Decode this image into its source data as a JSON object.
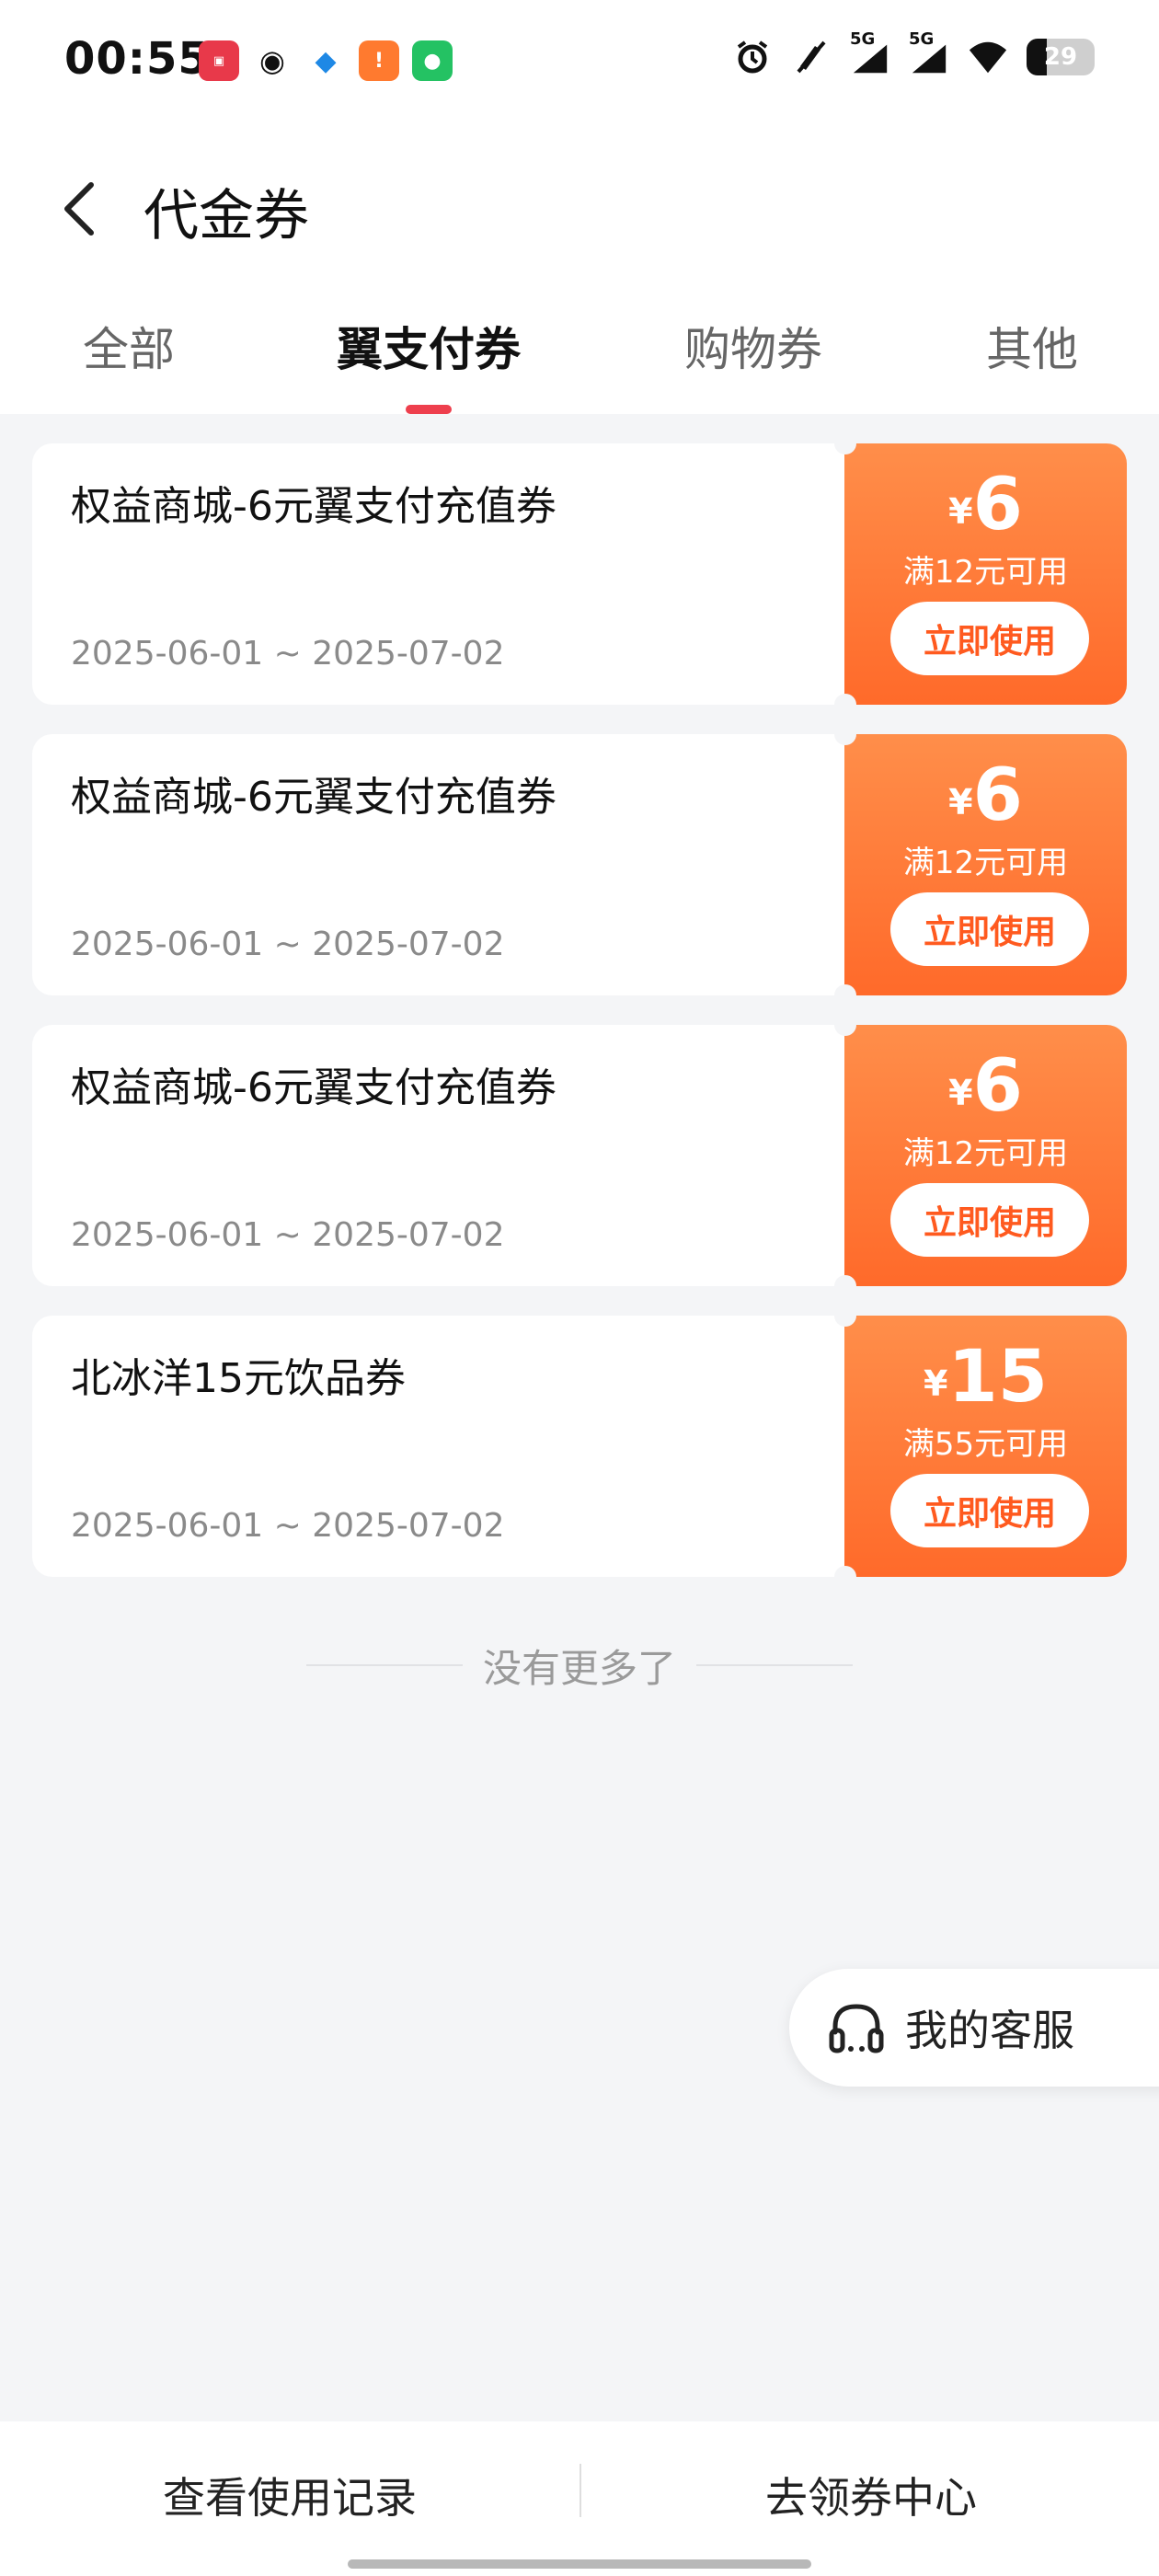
{
  "status_bar": {
    "time": "00:55",
    "app_icons": [
      "app-notification-icon-1",
      "qq-icon",
      "blue-app-icon",
      "warning-app-icon",
      "wechat-icon"
    ],
    "icons": [
      "alarm-icon",
      "mute-icon",
      "signal-5g-icon",
      "signal-5g-icon",
      "wifi-icon"
    ],
    "signal_label_1": "5G",
    "signal_label_2": "5G",
    "battery_level": "29"
  },
  "header": {
    "title": "代金券"
  },
  "tabs": {
    "items": [
      {
        "label": "全部",
        "active": false
      },
      {
        "label": "翼支付券",
        "active": true
      },
      {
        "label": "购物券",
        "active": false
      },
      {
        "label": "其他",
        "active": false
      }
    ],
    "accent_color": "#ee3f4d"
  },
  "coupons": [
    {
      "name": "权益商城-6元翼支付充值券",
      "date_range": "2025-06-01 ~ 2025-07-02",
      "currency": "¥",
      "amount": "6",
      "threshold": "满12元可用",
      "button_label": "立即使用"
    },
    {
      "name": "权益商城-6元翼支付充值券",
      "date_range": "2025-06-01 ~ 2025-07-02",
      "currency": "¥",
      "amount": "6",
      "threshold": "满12元可用",
      "button_label": "立即使用"
    },
    {
      "name": "权益商城-6元翼支付充值券",
      "date_range": "2025-06-01 ~ 2025-07-02",
      "currency": "¥",
      "amount": "6",
      "threshold": "满12元可用",
      "button_label": "立即使用"
    },
    {
      "name": "北冰洋15元饮品券",
      "date_range": "2025-06-01 ~ 2025-07-02",
      "currency": "¥",
      "amount": "15",
      "threshold": "满55元可用",
      "button_label": "立即使用"
    }
  ],
  "colors": {
    "coupon_gradient_top": "#ff8e4a",
    "coupon_gradient_bottom": "#ff6a2a",
    "button_text": "#ff5a1f"
  },
  "list_footer": {
    "text": "没有更多了"
  },
  "service": {
    "label": "我的客服",
    "icon": "headset-icon"
  },
  "bottom_bar": {
    "left_label": "查看使用记录",
    "right_label": "去领券中心"
  }
}
